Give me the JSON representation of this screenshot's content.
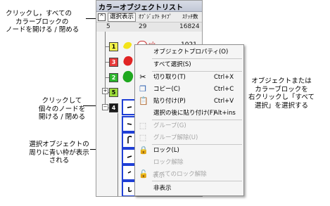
{
  "panel": {
    "title": "カラーオブジェクトリスト",
    "toolbar": {
      "show_selected": "選択表示",
      "object_type": "ｵﾌﾞｼﾞｪｸﾄ ﾀｲﾌﾟ",
      "stitch_count": "ｽﾃｯﾁ数"
    },
    "header": {
      "col1": "5",
      "col2": "29",
      "col3": "16824"
    },
    "first_row_count": "1021",
    "color_blocks": [
      {
        "label": "1",
        "color": "#f3f34a"
      },
      {
        "label": "3",
        "color": "#e83a3a"
      },
      {
        "label": "2",
        "color": "#2db72d"
      },
      {
        "label": "5",
        "color": "#9ddc3a"
      },
      {
        "label": "4",
        "color": "#1a1a1a"
      }
    ]
  },
  "context_menu": {
    "items": [
      {
        "label": "オブジェクトプロパティ(O)",
        "shortcut": "",
        "icon": "",
        "disabled": false
      },
      {
        "label": "すべて選択(S)",
        "shortcut": "",
        "icon": "",
        "disabled": false
      },
      {
        "label": "切り取り(T)",
        "shortcut": "Ctrl+X",
        "icon": "scissors-icon",
        "disabled": false
      },
      {
        "label": "コピー(C)",
        "shortcut": "Ctrl+C",
        "icon": "copy-icon",
        "disabled": false
      },
      {
        "label": "貼り付け(P)",
        "shortcut": "Ctrl+V",
        "icon": "paste-icon",
        "disabled": false
      },
      {
        "label": "選択の後に貼り付け(F)",
        "shortcut": "Alt+ins",
        "icon": "",
        "disabled": false
      },
      {
        "label": "グループ(G)",
        "shortcut": "",
        "icon": "group-icon",
        "disabled": true
      },
      {
        "label": "グループ解除(U)",
        "shortcut": "",
        "icon": "ungroup-icon",
        "disabled": true
      },
      {
        "label": "ロック(L)",
        "shortcut": "",
        "icon": "lock-icon",
        "disabled": false
      },
      {
        "label": "ロック解除",
        "shortcut": "",
        "icon": "",
        "disabled": true
      },
      {
        "label": "すべてのロック解除",
        "shortcut": "",
        "icon": "unlock-all-icon",
        "disabled": true
      },
      {
        "label": "表示",
        "shortcut": "",
        "icon": "",
        "disabled": true
      },
      {
        "label": "非表示",
        "shortcut": "",
        "icon": "",
        "disabled": false
      }
    ]
  },
  "callouts": {
    "top_left": [
      "クリックし，すべての",
      "カラーブロックの",
      "ノードを開ける / 閉める"
    ],
    "mid_left": [
      "クリックして",
      "個々のノードを",
      "開ける / 閉める"
    ],
    "bottom_left": [
      "選択オブジェクトの",
      "周りに青い枠が表示",
      "される"
    ],
    "right": [
      "オブジェクトまたは",
      "カラーブロックを",
      "右クリックし「すべて",
      "選択」を選択する"
    ]
  }
}
